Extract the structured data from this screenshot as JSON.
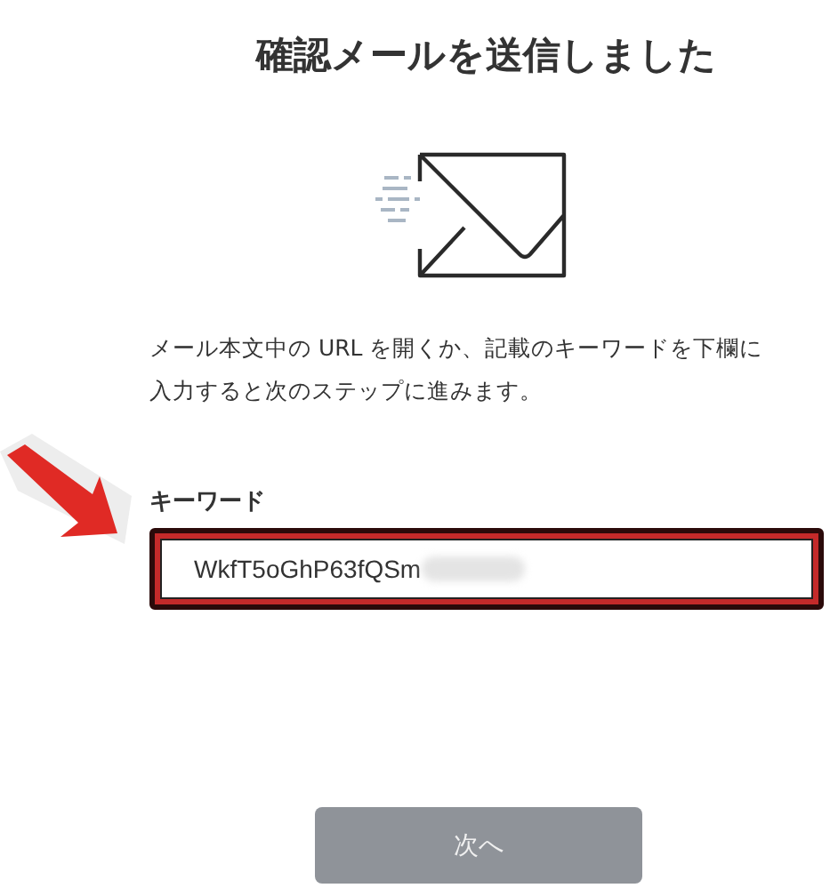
{
  "title": "確認メールを送信しました",
  "message": "メール本文中の URL を開くか、記載のキーワードを下欄に入力すると次のステップに進みます。",
  "keyword_field": {
    "label": "キーワード",
    "value": "WkfT5oGhP63fQSm",
    "highlighted": true,
    "redacted": true
  },
  "next_button": {
    "label": "次へ",
    "disabled": true
  }
}
